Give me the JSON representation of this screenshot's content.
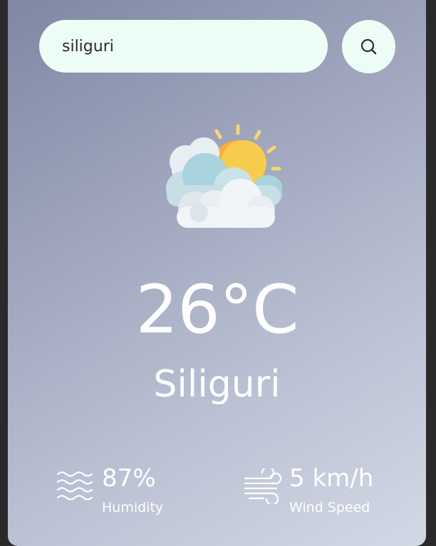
{
  "search": {
    "value": "siliguri",
    "placeholder": ""
  },
  "icons": {
    "search": "search-icon",
    "weather": "partly-cloudy-icon",
    "humidity": "humidity-waves-icon",
    "wind": "wind-icon"
  },
  "weather": {
    "temperature": "26°C",
    "city": "Siliguri"
  },
  "stats": {
    "humidity": {
      "value": "87%",
      "label": "Humidity"
    },
    "wind": {
      "value": "5 km/h",
      "label": "Wind Speed"
    }
  },
  "colors": {
    "input_background": "#ecfdf6",
    "card_gradient_start": "#7f87a4",
    "card_gradient_end": "#d3d8e5",
    "text": "#ffffff"
  }
}
